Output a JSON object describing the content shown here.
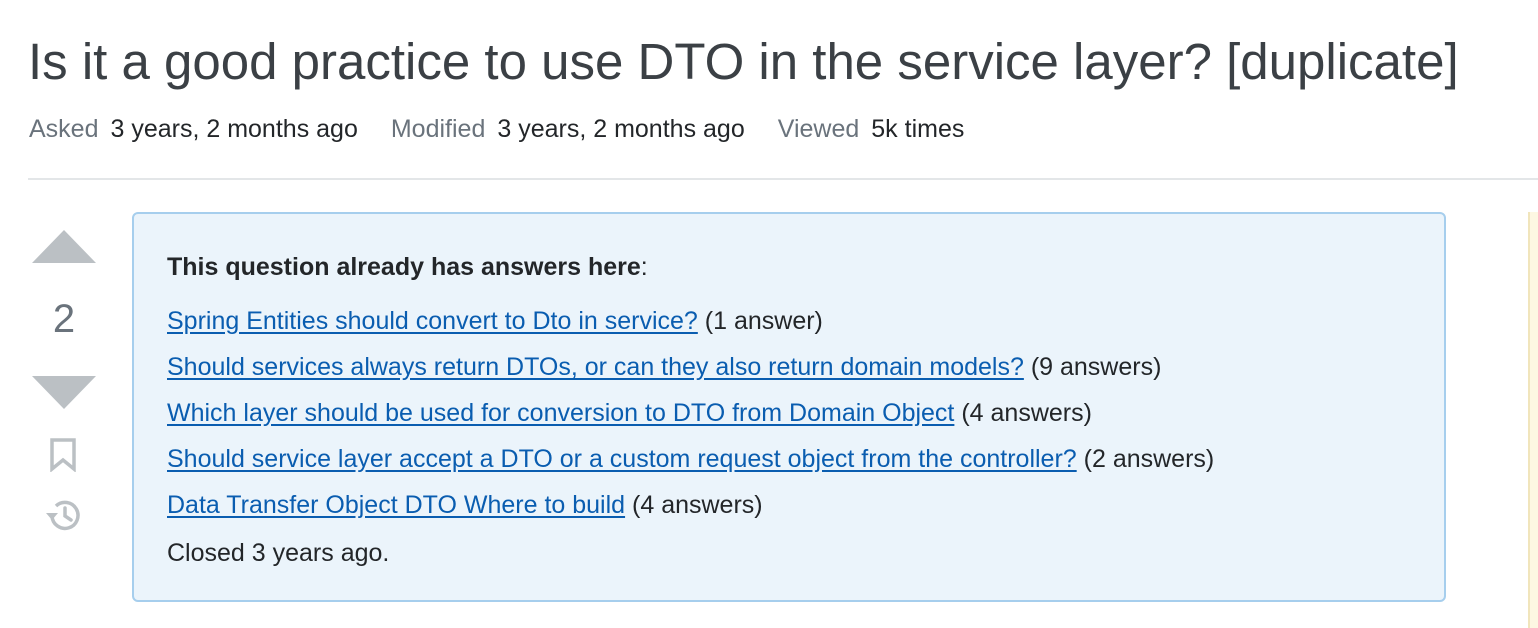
{
  "question": {
    "title": "Is it a good practice to use DTO in the service layer? [duplicate]",
    "meta": {
      "asked_label": "Asked",
      "asked_value": "3 years, 2 months ago",
      "modified_label": "Modified",
      "modified_value": "3 years, 2 months ago",
      "viewed_label": "Viewed",
      "viewed_value": "5k times"
    },
    "votes": "2",
    "icons": {
      "upvote": "upvote-arrow-icon",
      "downvote": "downvote-arrow-icon",
      "bookmark": "bookmark-icon",
      "history": "history-icon"
    }
  },
  "duplicate_notice": {
    "heading": "This question already has answers here",
    "heading_suffix": ":",
    "links": [
      {
        "text": "Spring Entities should convert to Dto in service?",
        "count": "(1 answer)"
      },
      {
        "text": "Should services always return DTOs, or can they also return domain models?",
        "count": "(9 answers)"
      },
      {
        "text": "Which layer should be used for conversion to DTO from Domain Object",
        "count": "(4 answers)"
      },
      {
        "text": "Should service layer accept a DTO or a custom request object from the controller?",
        "count": "(2 answers)"
      },
      {
        "text": "Data Transfer Object DTO Where to build",
        "count": "(4 answers)"
      }
    ],
    "closed_text": "Closed 3 years ago."
  },
  "colors": {
    "link": "#0a5db0",
    "notice_bg": "#ebf4fb",
    "notice_border": "#a6ceed",
    "vote_arrow": "#bbc0c4"
  }
}
